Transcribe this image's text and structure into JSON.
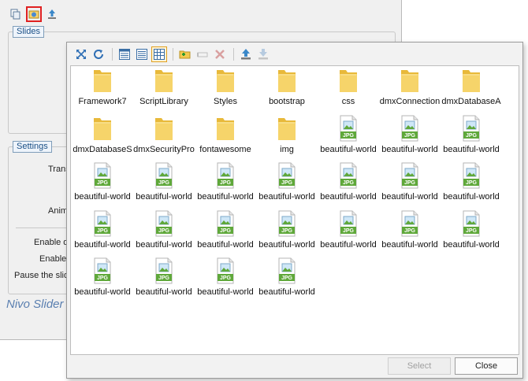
{
  "background_dialog": {
    "slides_title": "Slides",
    "settings_title": "Settings",
    "labels": [
      "Trans",
      "Anim",
      "Enable d",
      "Enable",
      "Pause the slid"
    ],
    "footer_text": "Nivo Slider"
  },
  "files": [
    {
      "name": "Framework7",
      "type": "folder"
    },
    {
      "name": "ScriptLibrary",
      "type": "folder"
    },
    {
      "name": "Styles",
      "type": "folder"
    },
    {
      "name": "bootstrap",
      "type": "folder"
    },
    {
      "name": "css",
      "type": "folder"
    },
    {
      "name": "dmxConnection",
      "type": "folder"
    },
    {
      "name": "dmxDatabaseA",
      "type": "folder"
    },
    {
      "name": "dmxDatabaseS",
      "type": "folder"
    },
    {
      "name": "dmxSecurityPro",
      "type": "folder"
    },
    {
      "name": "fontawesome",
      "type": "folder"
    },
    {
      "name": "img",
      "type": "folder"
    },
    {
      "name": "beautiful-world",
      "type": "jpg"
    },
    {
      "name": "beautiful-world",
      "type": "jpg"
    },
    {
      "name": "beautiful-world",
      "type": "jpg"
    },
    {
      "name": "beautiful-world",
      "type": "jpg"
    },
    {
      "name": "beautiful-world",
      "type": "jpg"
    },
    {
      "name": "beautiful-world",
      "type": "jpg"
    },
    {
      "name": "beautiful-world",
      "type": "jpg"
    },
    {
      "name": "beautiful-world",
      "type": "jpg"
    },
    {
      "name": "beautiful-world",
      "type": "jpg"
    },
    {
      "name": "beautiful-world",
      "type": "jpg"
    },
    {
      "name": "beautiful-world",
      "type": "jpg"
    },
    {
      "name": "beautiful-world",
      "type": "jpg"
    },
    {
      "name": "beautiful-world",
      "type": "jpg"
    },
    {
      "name": "beautiful-world",
      "type": "jpg"
    },
    {
      "name": "beautiful-world",
      "type": "jpg"
    },
    {
      "name": "beautiful-world",
      "type": "jpg"
    },
    {
      "name": "beautiful-world",
      "type": "jpg"
    },
    {
      "name": "beautiful-world",
      "type": "jpg"
    },
    {
      "name": "beautiful-world",
      "type": "jpg"
    },
    {
      "name": "beautiful-world",
      "type": "jpg"
    },
    {
      "name": "beautiful-world",
      "type": "jpg"
    }
  ],
  "jpg_badge": "JPG",
  "buttons": {
    "select": "Select",
    "close": "Close"
  },
  "icons": {
    "bg_toolbar": [
      "copy-icon",
      "image-browse-icon",
      "upload-icon"
    ],
    "browser_toolbar": [
      "expand-icon",
      "refresh-icon",
      "list-view-icon",
      "details-view-icon",
      "thumbnail-view-icon",
      "new-folder-icon",
      "rename-icon",
      "delete-icon",
      "upload-icon",
      "download-icon"
    ]
  },
  "colors": {
    "folder": "#f2c94c",
    "jpg": "#5fa83a",
    "highlight": "#e02020"
  }
}
